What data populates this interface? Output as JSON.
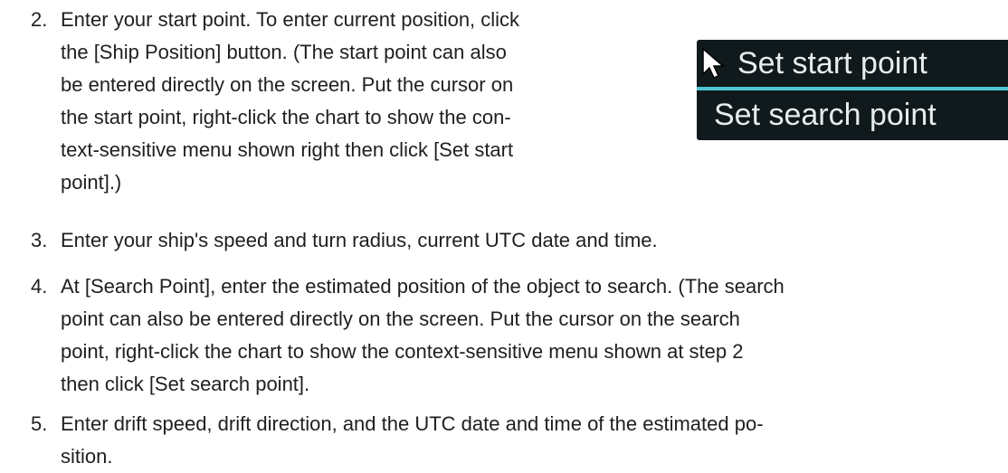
{
  "steps": [
    {
      "number": "2.",
      "lines": [
        "Enter your start point. To enter current position, click",
        "the [Ship Position] button. (The start point can also",
        "be entered directly on the screen. Put the cursor on",
        "the start point, right-click the chart to show the con-",
        "text-sensitive menu shown right then click [Set start",
        "point].)"
      ]
    },
    {
      "number": "3.",
      "lines": [
        "Enter your ship's speed and turn radius, current UTC date and time."
      ]
    },
    {
      "number": "4.",
      "lines": [
        "At [Search Point], enter the estimated position of the object to search. (The search",
        "point can also be entered directly on the screen. Put the cursor on the search",
        "point, right-click the chart to show the context-sensitive menu shown at step 2",
        "then click [Set search point]."
      ]
    },
    {
      "number": "5.",
      "lines": [
        "Enter drift speed, drift direction, and the UTC date and time of the estimated po-",
        "sition."
      ]
    }
  ],
  "context_menu": {
    "items": [
      {
        "label": "Set start point",
        "icon": "cursor-arrow-icon"
      },
      {
        "label": "Set search point"
      }
    ],
    "colors": {
      "background": "#101a1d",
      "text": "#e7ecee",
      "divider": "#4fc6d6"
    }
  }
}
